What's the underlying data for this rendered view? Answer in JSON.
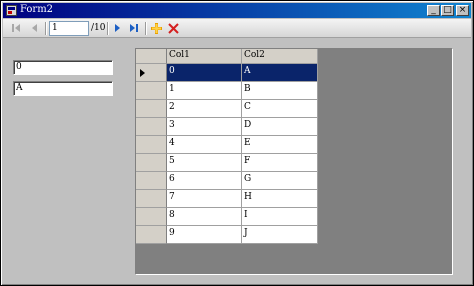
{
  "window": {
    "title": "Form2"
  },
  "titlebar_buttons": {
    "minimize": "_",
    "maximize": "□",
    "close": "×"
  },
  "navigator": {
    "position": "1",
    "count_label": "/10",
    "icons": {
      "move_first": "move-first-icon",
      "move_previous": "move-previous-icon",
      "move_next": "move-next-icon",
      "move_last": "move-last-icon",
      "add_new": "add-new-icon",
      "delete": "delete-icon"
    },
    "colors": {
      "nav_arrow": "#1c5fc4",
      "disabled": "#a8a8a8",
      "add": "#e8a000",
      "delete": "#d42020"
    }
  },
  "fields": {
    "col1_value": "0",
    "col2_value": "A"
  },
  "grid": {
    "columns": [
      "Col1",
      "Col2"
    ],
    "selected_row": 0,
    "rows": [
      [
        "0",
        "A"
      ],
      [
        "1",
        "B"
      ],
      [
        "2",
        "C"
      ],
      [
        "3",
        "D"
      ],
      [
        "4",
        "E"
      ],
      [
        "5",
        "F"
      ],
      [
        "6",
        "G"
      ],
      [
        "7",
        "H"
      ],
      [
        "8",
        "I"
      ],
      [
        "9",
        "J"
      ]
    ],
    "selection_color": "#0a246a"
  }
}
